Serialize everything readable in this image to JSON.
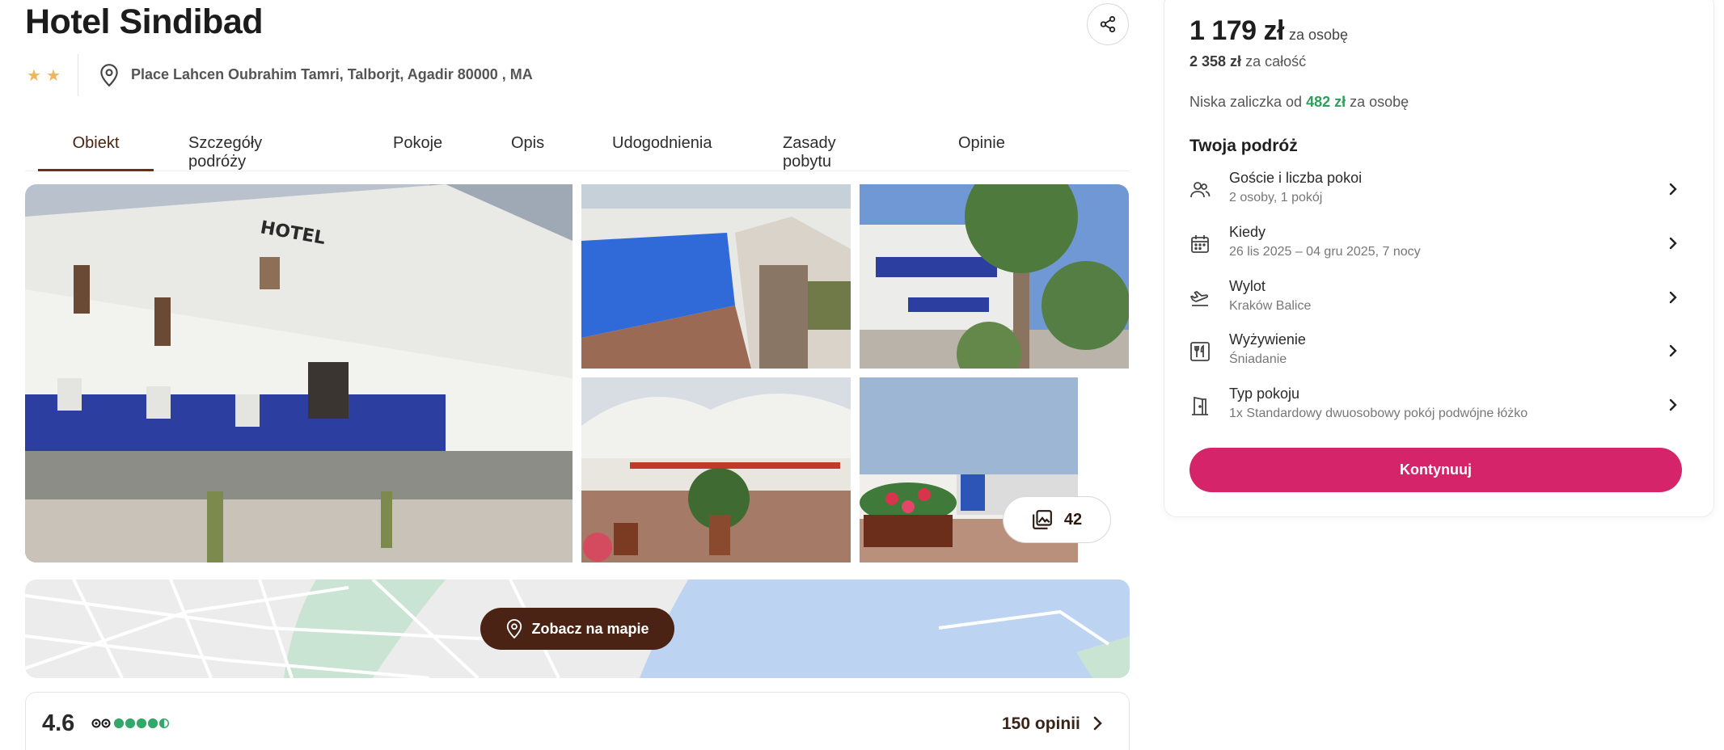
{
  "hotel": {
    "name": "Hotel Sindibad",
    "stars": 2,
    "address": "Place Lahcen Oubrahim Tamri, Talborjt, Agadir 80000 , MA"
  },
  "tabs": [
    {
      "label": "Obiekt",
      "active": true
    },
    {
      "label": "Szczegóły podróży",
      "active": false
    },
    {
      "label": "Pokoje",
      "active": false
    },
    {
      "label": "Opis",
      "active": false
    },
    {
      "label": "Udogodnienia",
      "active": false
    },
    {
      "label": "Zasady pobytu",
      "active": false
    },
    {
      "label": "Opinie",
      "active": false
    }
  ],
  "gallery": {
    "photo_count": "42"
  },
  "map": {
    "button_label": "Zobacz na mapie"
  },
  "rating": {
    "score": "4.6",
    "bubbles_filled": 4.5,
    "reviews_label": "150 opinii"
  },
  "pricing": {
    "per_person_price": "1 179 zł",
    "per_person_unit": "za osobę",
    "total_price": "2 358 zł",
    "total_unit": "za całość",
    "deposit_prefix": "Niska zaliczka od",
    "deposit_amount": "482 zł",
    "deposit_suffix": "za osobę"
  },
  "trip": {
    "title": "Twoja podróż",
    "rows": [
      {
        "icon": "guests-icon",
        "label": "Goście i liczba pokoi",
        "value": "2 osoby, 1 pokój"
      },
      {
        "icon": "calendar-icon",
        "label": "Kiedy",
        "value": "26 lis 2025 – 04 gru 2025, 7 nocy"
      },
      {
        "icon": "plane-departure-icon",
        "label": "Wylot",
        "value": "Kraków Balice"
      },
      {
        "icon": "meal-icon",
        "label": "Wyżywienie",
        "value": "Śniadanie"
      },
      {
        "icon": "door-icon",
        "label": "Typ pokoju",
        "value": "1x Standardowy dwuosobowy pokój podwójne łóżko"
      }
    ],
    "continue_label": "Kontynuuj"
  },
  "colors": {
    "brand_brown": "#4a2314",
    "cta_pink": "#d6246a",
    "deposit_green": "#2e9e5b",
    "star_gold": "#f0b45c",
    "tripadvisor_green": "#34a86a"
  }
}
